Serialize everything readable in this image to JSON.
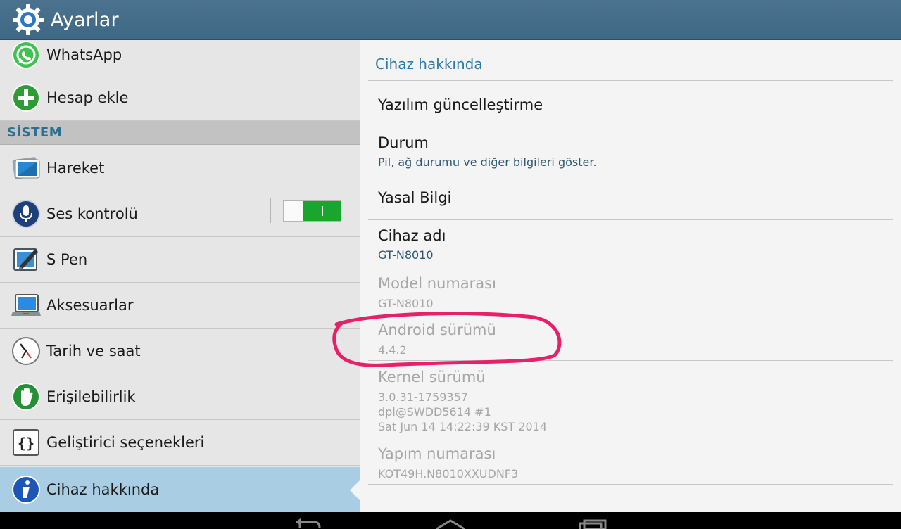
{
  "actionbar": {
    "title": "Ayarlar",
    "icon": "gear-icon"
  },
  "left": {
    "items_top": [
      {
        "label": "WhatsApp",
        "icon": "whatsapp-icon"
      },
      {
        "label": "Hesap ekle",
        "icon": "add-account-icon"
      }
    ],
    "section_label": "SİSTEM",
    "items": [
      {
        "label": "Hareket",
        "icon": "motion-icon"
      },
      {
        "label": "Ses kontrolü",
        "icon": "microphone-icon",
        "toggle_on": true
      },
      {
        "label": "S Pen",
        "icon": "s-pen-icon"
      },
      {
        "label": "Aksesuarlar",
        "icon": "accessory-icon"
      },
      {
        "label": "Tarih ve saat",
        "icon": "clock-icon"
      },
      {
        "label": "Erişilebilirlik",
        "icon": "accessibility-hand-icon"
      },
      {
        "label": "Geliştirici seçenekleri",
        "icon": "developer-braces-icon"
      },
      {
        "label": "Cihaz hakkında",
        "icon": "info-icon",
        "selected": true
      }
    ]
  },
  "right": {
    "title": "Cihaz hakkında",
    "items": [
      {
        "title": "Yazılım güncelleştirme"
      },
      {
        "title": "Durum",
        "summary": "Pil, ağ durumu ve diğer bilgileri göster."
      },
      {
        "title": "Yasal Bilgi"
      },
      {
        "title": "Cihaz adı",
        "summary": "GT-N8010"
      },
      {
        "title": "Model numarası",
        "summary": "GT-N8010"
      },
      {
        "title": "Android sürümü",
        "summary": "4.4.2"
      },
      {
        "title": "Kernel sürümü",
        "summary_lines": [
          "3.0.31-1759357",
          "dpi@SWDD5614 #1",
          "Sat Jun 14 14:22:39 KST 2014"
        ]
      },
      {
        "title": "Yapım numarası",
        "summary": "KOT49H.N8010XXUDNF3"
      }
    ]
  },
  "colors": {
    "actionbar": "#43708e",
    "accent": "#2b7aa8",
    "section_text": "#2b6f92",
    "selected_row": "#a9cde2",
    "toggle_on": "#1aa52e",
    "annotation": "#e8206a"
  },
  "navbar": {
    "icons": [
      "back-icon",
      "home-icon",
      "recent-apps-icon"
    ]
  }
}
